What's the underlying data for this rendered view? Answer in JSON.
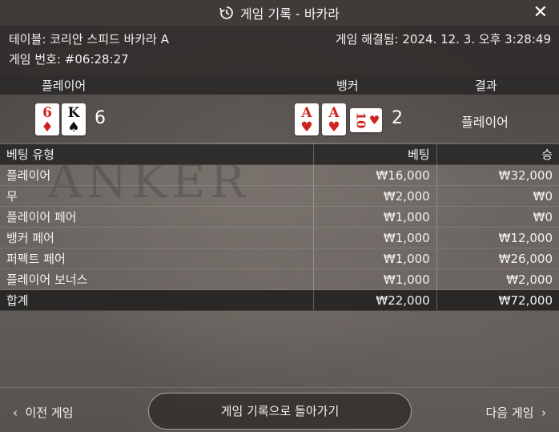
{
  "header": {
    "title": "게임 기록 - 바카라",
    "close_label": "✕"
  },
  "info": {
    "table": "테이블: 코리안 스피드 바카라 A",
    "resolved": "게임 해결됨: 2024. 12. 3. 오후 3:28:49",
    "game_no": "게임 번호: #06:28:27"
  },
  "results": {
    "player_label": "플레이어",
    "banker_label": "뱅커",
    "result_label": "결과",
    "player_cards": [
      {
        "rank": "6",
        "suit": "♦"
      },
      {
        "rank": "K",
        "suit": "♠"
      }
    ],
    "player_score": "6",
    "banker_cards": [
      {
        "rank": "A",
        "suit": "♥"
      },
      {
        "rank": "A",
        "suit": "♥"
      },
      {
        "rank": "10",
        "suit": "♥"
      }
    ],
    "banker_score": "2",
    "result": "플레이어"
  },
  "bets": {
    "headers": {
      "type": "베팅 유형",
      "bet": "베팅",
      "win": "승"
    },
    "rows": [
      {
        "type": "플레이어",
        "bet": "₩16,000",
        "win": "₩32,000"
      },
      {
        "type": "무",
        "bet": "₩2,000",
        "win": "₩0"
      },
      {
        "type": "플레이어 페어",
        "bet": "₩1,000",
        "win": "₩0"
      },
      {
        "type": "뱅커 페어",
        "bet": "₩1,000",
        "win": "₩12,000"
      },
      {
        "type": "퍼펙트 페어",
        "bet": "₩1,000",
        "win": "₩26,000"
      },
      {
        "type": "플레이어 보너스",
        "bet": "₩1,000",
        "win": "₩2,000"
      }
    ],
    "total": {
      "type": "합계",
      "bet": "₩22,000",
      "win": "₩72,000"
    }
  },
  "footer": {
    "prev": "이전 게임",
    "back": "게임 기록으로 돌아가기",
    "next": "다음 게임"
  },
  "icons": {
    "history": "history-icon",
    "prev": "chevron-left-icon",
    "next": "chevron-right-icon",
    "close": "close-icon"
  }
}
